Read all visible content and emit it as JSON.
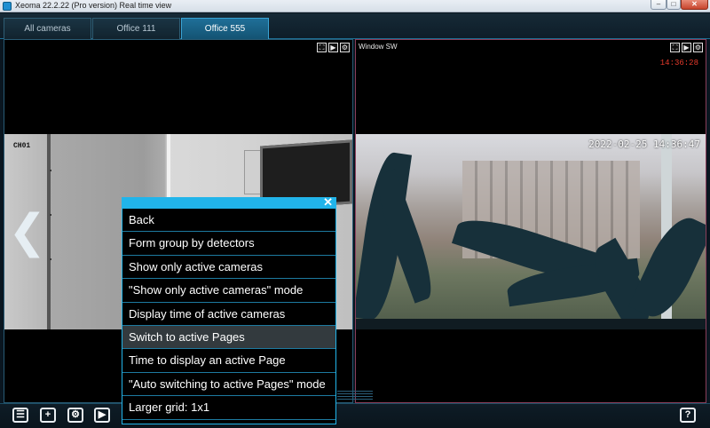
{
  "window": {
    "title": "Xeoma 22.2.22 (Pro version) Real time view",
    "min_glyph": "–",
    "max_glyph": "□",
    "close_glyph": "✕"
  },
  "tabs": [
    {
      "label": "All cameras",
      "active": false
    },
    {
      "label": "Office 111",
      "active": false
    },
    {
      "label": "Office 555",
      "active": true
    }
  ],
  "cameras": {
    "left": {
      "overlay_label": "CH01",
      "controls": [
        "⛶",
        "▶",
        "⚙"
      ]
    },
    "right": {
      "name": "Window SW",
      "clock": "14:36:28",
      "timestamp": "2022-02-25  14:36:47",
      "controls": [
        "⛶",
        "▶",
        "⚙"
      ]
    },
    "prev_arrow": "❮"
  },
  "menu": {
    "close_glyph": "✕",
    "items": [
      {
        "label": "Back",
        "active": false
      },
      {
        "label": "Form group by detectors",
        "active": false
      },
      {
        "label": "Show only active cameras",
        "active": false
      },
      {
        "label": "\"Show only active cameras\" mode",
        "active": false
      },
      {
        "label": "Display time of active cameras",
        "active": false
      },
      {
        "label": "Switch to active Pages",
        "active": true
      },
      {
        "label": "Time to display an active Page",
        "active": false
      },
      {
        "label": "\"Auto switching to active Pages\" mode",
        "active": false
      },
      {
        "label": "Larger grid: 1x1",
        "active": false
      }
    ]
  },
  "toolbar": {
    "list_glyph": "☰",
    "add_glyph": "+",
    "settings_glyph": "⚙",
    "play_glyph": "▶",
    "help_glyph": "?"
  },
  "colors": {
    "accent": "#21b4ea",
    "clock_red": "#e53a2b",
    "active_tab": "#1f6f98"
  }
}
